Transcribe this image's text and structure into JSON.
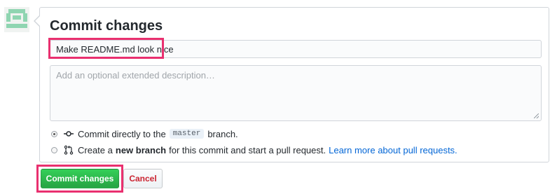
{
  "panel": {
    "title": "Commit changes"
  },
  "summary": {
    "value": "Make README.md look nice"
  },
  "description": {
    "placeholder": "Add an optional extended description…"
  },
  "options": {
    "direct": {
      "prefix": "Commit directly to the",
      "branch": "master",
      "suffix": "branch.",
      "icon": "git-commit-icon",
      "checked": true
    },
    "new_branch": {
      "prefix": "Create a",
      "bold": "new branch",
      "suffix": "for this commit and start a pull request.",
      "link": "Learn more about pull requests.",
      "icon": "git-pull-request-icon",
      "checked": false
    }
  },
  "buttons": {
    "commit": "Commit changes",
    "cancel": "Cancel"
  },
  "colors": {
    "highlight": "#e9306f",
    "commit_green": "#28a745",
    "cancel_red": "#cb2431",
    "link_blue": "#0366d6"
  }
}
